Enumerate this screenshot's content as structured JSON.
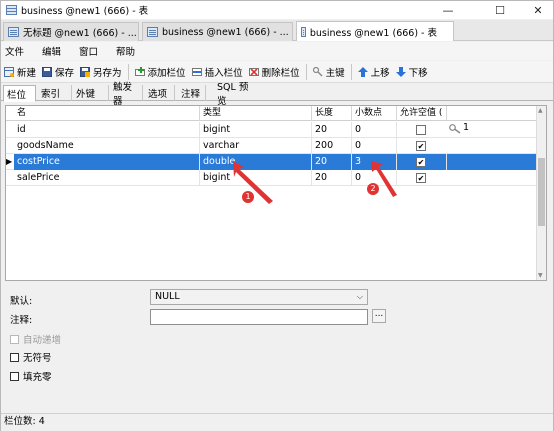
{
  "window": {
    "title": "business @new1 (666) - 表",
    "minimize": "—",
    "maximize": "☐",
    "close": "✕"
  },
  "doc_tabs": [
    {
      "label": "无标题 @new1 (666) - ..."
    },
    {
      "label": "business @new1 (666) - ..."
    },
    {
      "label": "business @new1 (666) - 表"
    }
  ],
  "menu": [
    "文件",
    "编辑",
    "窗口",
    "帮助"
  ],
  "toolbar": {
    "new": "新建",
    "save": "保存",
    "save_as": "另存为",
    "add_field": "添加栏位",
    "insert_field": "插入栏位",
    "delete_field": "删除栏位",
    "primary_key": "主键",
    "move_up": "上移",
    "move_down": "下移"
  },
  "sub_tabs": [
    "栏位",
    "索引",
    "外键",
    "触发器",
    "选项",
    "注释",
    "SQL 预览"
  ],
  "grid": {
    "headers": [
      "名",
      "类型",
      "长度",
      "小数点",
      "允许空值 ("
    ],
    "rows": [
      {
        "name": "id",
        "type": "bigint",
        "length": "20",
        "decimals": "0",
        "nullable": false,
        "key": "1"
      },
      {
        "name": "goodsName",
        "type": "varchar",
        "length": "200",
        "decimals": "0",
        "nullable": true,
        "key": ""
      },
      {
        "name": "costPrice",
        "type": "double",
        "length": "20",
        "decimals": "3",
        "nullable": true,
        "key": "",
        "selected": true
      },
      {
        "name": "salePrice",
        "type": "bigint",
        "length": "20",
        "decimals": "0",
        "nullable": true,
        "key": ""
      }
    ],
    "check_mark": "✔",
    "key_icon": "key-icon"
  },
  "annotations": {
    "badge1": "1",
    "badge2": "2",
    "color": "#e03434"
  },
  "form": {
    "default_label": "默认:",
    "default_value": "NULL",
    "comment_label": "注释:",
    "comment_button": "...",
    "auto_increment": "自动递增",
    "unsigned": "无符号",
    "zerofill": "填充零"
  },
  "status": "栏位数: 4",
  "colors": {
    "selection": "#2a7ad8",
    "accent": "#e03434"
  }
}
